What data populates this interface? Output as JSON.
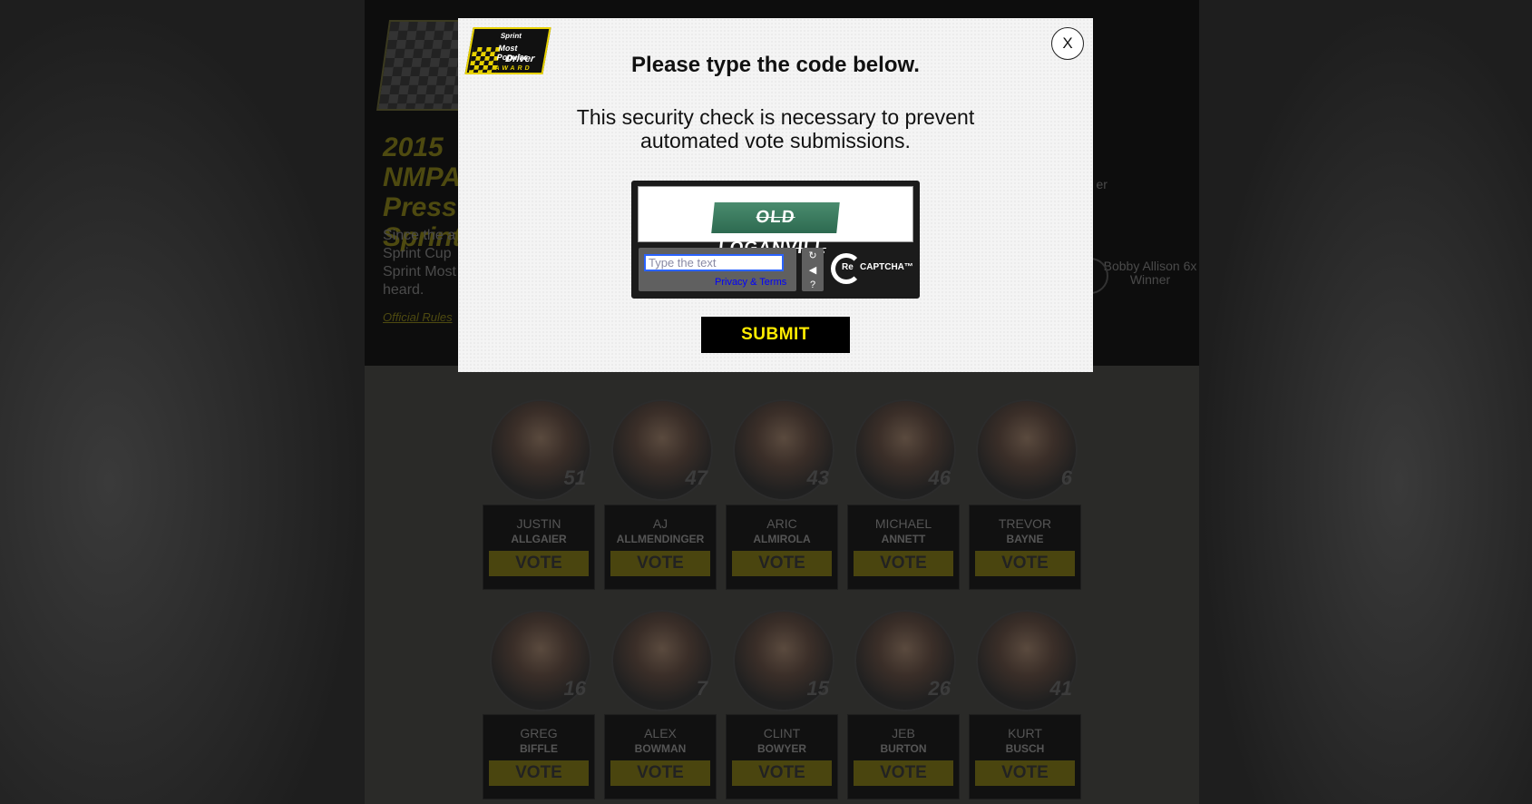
{
  "modal": {
    "logo": {
      "sponsor": "Sprint",
      "org": "NMPA",
      "line1": "Most Popular",
      "line2": "Driver",
      "line3": "AWARD"
    },
    "close_label": "X",
    "title": "Please type the code below.",
    "description": "This security check is necessary to prevent automated vote submissions.",
    "captcha": {
      "image_text": "OLD LOGANVILL",
      "input_placeholder": "Type the text",
      "privacy_link": "Privacy & Terms",
      "tools": [
        "reload-icon",
        "audio-icon",
        "help-icon"
      ],
      "tool_glyphs": [
        "↻",
        "◀",
        "?"
      ],
      "brand_re": "Re",
      "brand_captcha": "CAPTCHA™"
    },
    "submit_label": "SUBMIT"
  },
  "background": {
    "headline": "2015 NMPA Press Sprint",
    "blurb": "Since the a Sprint Cup Sprint Most heard.",
    "official_rules": "Official Rules",
    "side_text_1": "etty er",
    "side_text_2": "Bobby Allison 6x Winner",
    "vote_label": "VOTE",
    "drivers_row1": [
      {
        "first": "JUSTIN",
        "last": "ALLGAIER",
        "number": "51"
      },
      {
        "first": "AJ",
        "last": "ALLMENDINGER",
        "number": "47"
      },
      {
        "first": "ARIC",
        "last": "ALMIROLA",
        "number": "43"
      },
      {
        "first": "MICHAEL",
        "last": "ANNETT",
        "number": "46"
      },
      {
        "first": "TREVOR",
        "last": "BAYNE",
        "number": "6"
      }
    ],
    "drivers_row2": [
      {
        "first": "GREG",
        "last": "BIFFLE",
        "number": "16"
      },
      {
        "first": "ALEX",
        "last": "BOWMAN",
        "number": "7"
      },
      {
        "first": "CLINT",
        "last": "BOWYER",
        "number": "15"
      },
      {
        "first": "JEB",
        "last": "BURTON",
        "number": "26"
      },
      {
        "first": "KURT",
        "last": "BUSCH",
        "number": "41"
      }
    ]
  }
}
